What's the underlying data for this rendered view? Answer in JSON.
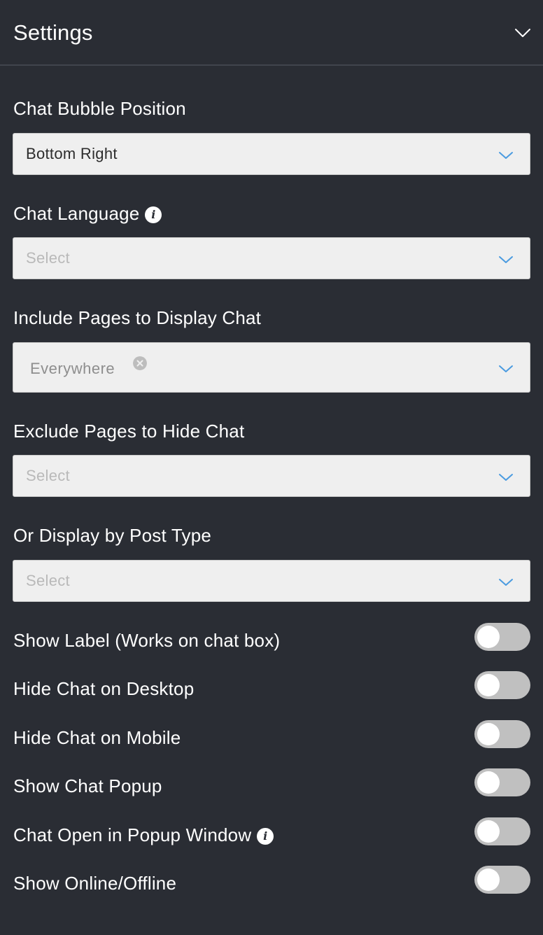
{
  "header": {
    "title": "Settings"
  },
  "fields": {
    "bubble_position": {
      "label": "Chat Bubble Position",
      "value": "Bottom Right"
    },
    "chat_language": {
      "label": "Chat Language",
      "placeholder": "Select"
    },
    "include_pages": {
      "label": "Include Pages to Display Chat",
      "tag": "Everywhere"
    },
    "exclude_pages": {
      "label": "Exclude Pages to Hide Chat",
      "placeholder": "Select"
    },
    "post_type": {
      "label": "Or Display by Post Type",
      "placeholder": "Select"
    }
  },
  "toggles": [
    {
      "label": "Show Label (Works on chat box)",
      "enabled": false
    },
    {
      "label": "Hide Chat on Desktop",
      "enabled": false
    },
    {
      "label": "Hide Chat on Mobile",
      "enabled": false
    },
    {
      "label": "Show Chat Popup",
      "enabled": false
    },
    {
      "label": "Chat Open in Popup Window",
      "enabled": false
    },
    {
      "label": "Show Online/Offline",
      "enabled": false
    }
  ],
  "icons": {
    "collapse": "chevron-down-icon",
    "info": "info-icon",
    "select_arrow": "chevron-down-icon",
    "tag_remove": "close-circle-icon"
  },
  "colors": {
    "background": "#2a2d34",
    "select_background": "#efefef",
    "chevron_accent": "#4a9be0",
    "toggle_off": "#c0c0c0"
  }
}
